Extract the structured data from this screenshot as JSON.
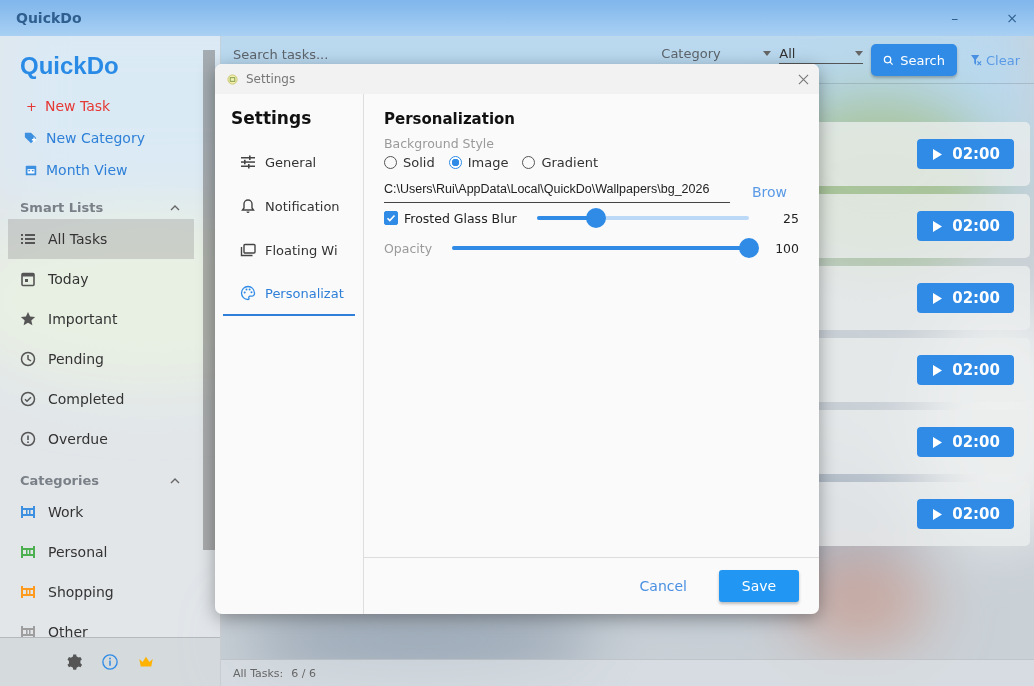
{
  "window": {
    "title": "QuickDo",
    "controls": [
      "–",
      "×"
    ]
  },
  "sidebar": {
    "logo": "QuickDo",
    "actions": [
      {
        "kind": "task",
        "icon": "+",
        "label": "New Task"
      },
      {
        "kind": "category",
        "label": "New Category"
      },
      {
        "kind": "calendar",
        "label": "Month View"
      }
    ],
    "sections": [
      {
        "title": "Smart Lists",
        "expanded": true,
        "items": [
          {
            "kind": "list",
            "label": "All Tasks",
            "selected": true
          },
          {
            "kind": "calendar",
            "label": "Today",
            "selected": false
          },
          {
            "kind": "star",
            "label": "Important",
            "selected": false
          },
          {
            "kind": "clock",
            "label": "Pending",
            "selected": false
          },
          {
            "kind": "check",
            "label": "Completed",
            "selected": false
          },
          {
            "kind": "alert",
            "label": "Overdue",
            "selected": false
          }
        ]
      },
      {
        "title": "Categories",
        "expanded": true,
        "items": [
          {
            "kind": "category",
            "label": "Work",
            "color": "#3d8fe0",
            "selected": false
          },
          {
            "kind": "category",
            "label": "Personal",
            "color": "#4caf50",
            "selected": false
          },
          {
            "kind": "category",
            "label": "Shopping",
            "color": "#ff9a1f",
            "selected": false
          },
          {
            "kind": "category",
            "label": "Other",
            "color": "#9e9e9e",
            "selected": false
          }
        ]
      }
    ]
  },
  "toolbar": {
    "search": {
      "placeholder": "Search tasks..."
    },
    "category": {
      "placeholder": "Category",
      "value": "All"
    },
    "search_button": "Search",
    "clear_button": "Clear"
  },
  "tasks": [
    {
      "timer": "02:00"
    },
    {
      "timer": "02:00"
    },
    {
      "timer": "02:00"
    },
    {
      "timer": "02:00"
    },
    {
      "timer": "02:00"
    },
    {
      "timer": "02:00"
    }
  ],
  "status_bar": {
    "label": "All Tasks:",
    "count": "6 / 6"
  },
  "dialog": {
    "title": "Settings",
    "heading": "Settings",
    "nav": [
      {
        "kind": "general",
        "label": "General",
        "selected": false
      },
      {
        "kind": "bell",
        "label": "Notification",
        "selected": false
      },
      {
        "kind": "window",
        "label": "Floating Wi",
        "selected": false
      },
      {
        "kind": "palette",
        "label": "Personalizat",
        "selected": true
      }
    ],
    "section_title": "Personalization",
    "background_style_label": "Background Style",
    "background_options": [
      {
        "label": "Solid",
        "selected": false
      },
      {
        "label": "Image",
        "selected": true
      },
      {
        "label": "Gradient",
        "selected": false
      }
    ],
    "path": {
      "value": "C:\\Users\\Rui\\AppData\\Local\\QuickDo\\Wallpapers\\bg_2026"
    },
    "browse_button": "Brow",
    "blur": {
      "label": "Frosted Glass Blur",
      "checked": true,
      "level": 0.28,
      "reading": "25"
    },
    "opacity": {
      "label": "Opacity",
      "level": 1,
      "reading": "100"
    },
    "cancel_button": "Cancel",
    "save_button": "Save"
  }
}
